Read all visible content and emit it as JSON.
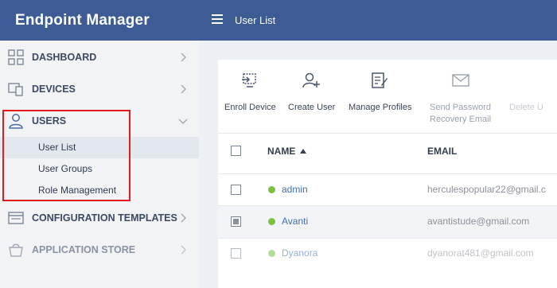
{
  "app": {
    "title": "Endpoint Manager"
  },
  "header": {
    "title": "User List"
  },
  "sidebar": {
    "items": [
      {
        "label": "DASHBOARD",
        "icon": "dashboard-icon"
      },
      {
        "label": "DEVICES",
        "icon": "devices-icon"
      },
      {
        "label": "USERS",
        "icon": "user-icon",
        "expanded": true
      },
      {
        "label": "CONFIGURATION TEMPLATES",
        "icon": "templates-icon"
      },
      {
        "label": "APPLICATION STORE",
        "icon": "store-icon"
      }
    ],
    "users_subitems": [
      {
        "label": "User List",
        "active": true
      },
      {
        "label": "User Groups"
      },
      {
        "label": "Role Management"
      }
    ]
  },
  "toolbar": {
    "enroll_device": "Enroll Device",
    "create_user": "Create User",
    "manage_profiles": "Manage Profiles",
    "send_password_line1": "Send Password",
    "send_password_line2": "Recovery Email",
    "delete_user": "Delete U"
  },
  "table": {
    "columns": {
      "name": "NAME",
      "email": "EMAIL"
    },
    "rows": [
      {
        "name": "admin",
        "email": "herculespopular22@gmail.c",
        "checked": false,
        "status_color": "#7cc242"
      },
      {
        "name": "Avanti",
        "email": "avantistude@gmail.com",
        "checked": true,
        "status_color": "#7cc242"
      },
      {
        "name": "Dyanora",
        "email": "dyanorat481@gmail.com",
        "checked": false,
        "status_color": "#7cc242"
      }
    ]
  },
  "colors": {
    "brand": "#3d5b94",
    "highlight": "#e21b1b",
    "link": "#3f6fb5",
    "status_online": "#7cc242"
  }
}
